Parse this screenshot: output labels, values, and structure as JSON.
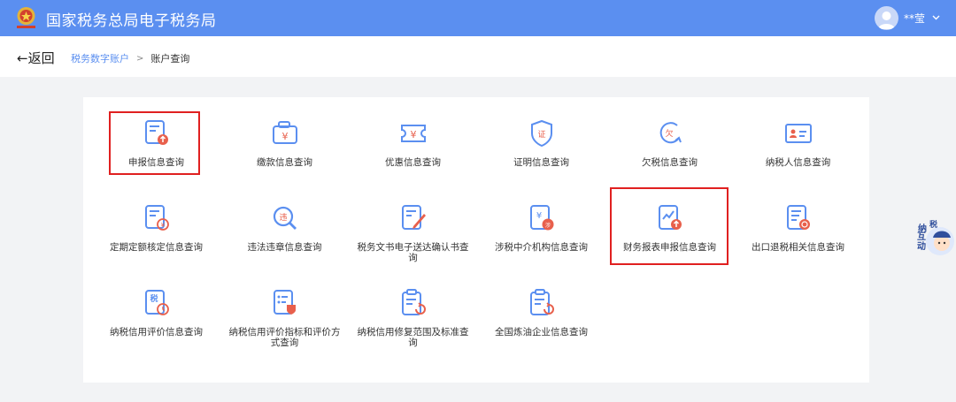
{
  "header": {
    "title": "国家税务总局电子税务局",
    "user_name": "**莹",
    "logo_icon": "tax-emblem-icon",
    "colors": {
      "bar": "#5b8ff0"
    }
  },
  "nav": {
    "back_label": "←返回",
    "breadcrumb": [
      "税务数字账户",
      "账户查询"
    ],
    "separator": ">"
  },
  "tiles": [
    {
      "label": "申报信息查询",
      "icon": "declaration-icon",
      "highlighted": true
    },
    {
      "label": "缴款信息查询",
      "icon": "payment-icon"
    },
    {
      "label": "优惠信息查询",
      "icon": "discount-icon"
    },
    {
      "label": "证明信息查询",
      "icon": "certificate-icon"
    },
    {
      "label": "欠税信息查询",
      "icon": "arrears-icon"
    },
    {
      "label": "纳税人信息查询",
      "icon": "taxpayer-card-icon"
    },
    {
      "label": "定期定额核定信息查询",
      "icon": "fixed-quota-icon"
    },
    {
      "label": "违法违章信息查询",
      "icon": "violation-search-icon"
    },
    {
      "label": "税务文书电子送达确认书查询",
      "icon": "document-edit-icon"
    },
    {
      "label": "涉税中介机构信息查询",
      "icon": "agency-icon"
    },
    {
      "label": "财务报表申报信息查询",
      "icon": "financial-report-icon",
      "highlighted": true
    },
    {
      "label": "出口退税相关信息查询",
      "icon": "export-refund-icon"
    },
    {
      "label": "纳税信用评价信息查询",
      "icon": "credit-evaluation-icon"
    },
    {
      "label": "纳税信用评价指标和评价方式查询",
      "icon": "credit-index-icon"
    },
    {
      "label": "纳税信用修复范围及标准查询",
      "icon": "credit-repair-icon"
    },
    {
      "label": "全国炼油企业信息查询",
      "icon": "refinery-icon"
    }
  ],
  "float_help": {
    "label_a": "纳",
    "label_b": "互动",
    "label_c": "税"
  },
  "colors": {
    "accent": "#5b8ff0",
    "highlight": "#e02020",
    "icon_red": "#e8604c"
  }
}
